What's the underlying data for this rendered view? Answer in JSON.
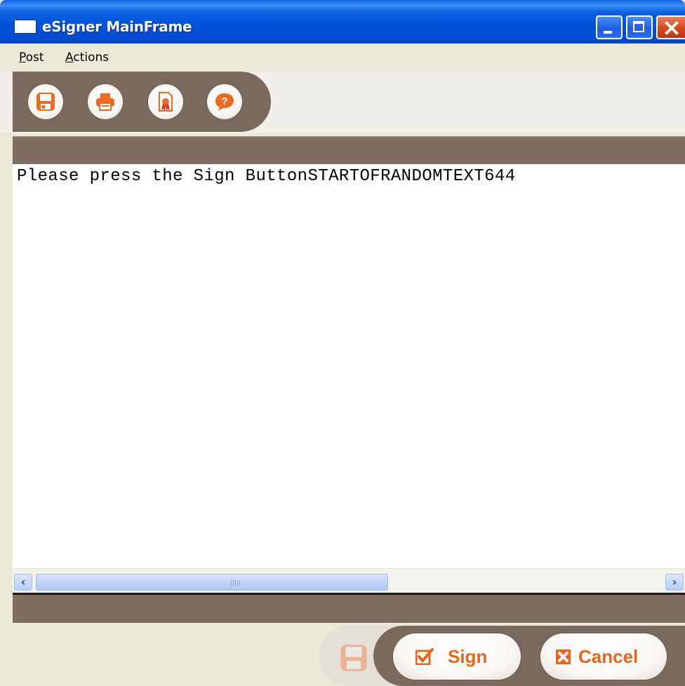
{
  "window": {
    "title": "eSigner MainFrame"
  },
  "menubar": {
    "items": [
      {
        "label_underlined": "P",
        "label_rest": "ost"
      },
      {
        "label_underlined": "A",
        "label_rest": "ctions"
      }
    ]
  },
  "toolbar": {
    "buttons": [
      {
        "icon": "floppy-save-icon"
      },
      {
        "icon": "printer-icon"
      },
      {
        "icon": "certificate-icon"
      },
      {
        "icon": "help-icon"
      }
    ]
  },
  "content": {
    "text": "Please press the Sign ButtonSTARTOFRANDOMTEXT644"
  },
  "actions": {
    "sign_label": "Sign",
    "cancel_label": "Cancel"
  },
  "colors": {
    "accent": "#e8651a",
    "brown": "#7a6a5e",
    "titlebar": "#0052d9"
  }
}
